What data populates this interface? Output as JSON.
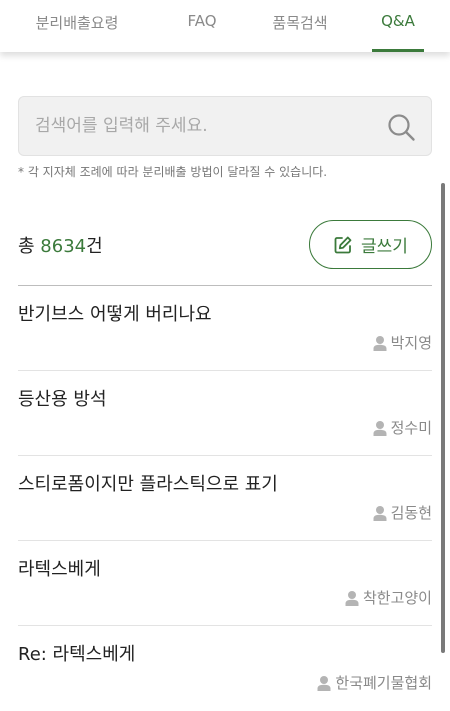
{
  "tabs": [
    {
      "label": "분리배출요령"
    },
    {
      "label": "FAQ"
    },
    {
      "label": "품목검색"
    },
    {
      "label": "Q&A"
    }
  ],
  "search": {
    "placeholder": "검색어를 입력해 주세요."
  },
  "notice": "* 각 지자체 조례에 따라 분리배출 방법이 달라질 수 있습니다.",
  "summary": {
    "prefix": "총 ",
    "count": "8634",
    "suffix": "건"
  },
  "write_button": {
    "label": "글쓰기"
  },
  "posts": [
    {
      "title": "반기브스 어떻게 버리나요",
      "author": "박지영"
    },
    {
      "title": "등산용 방석",
      "author": "정수미"
    },
    {
      "title": "스티로폼이지만 플라스틱으로 표기",
      "author": "김동현"
    },
    {
      "title": "라텍스베게",
      "author": "착한고양이"
    },
    {
      "title": "Re: 라텍스베게",
      "author": "한국폐기물협회"
    }
  ],
  "colors": {
    "accent": "#3b7a3b",
    "muted": "#8a8a8a"
  }
}
